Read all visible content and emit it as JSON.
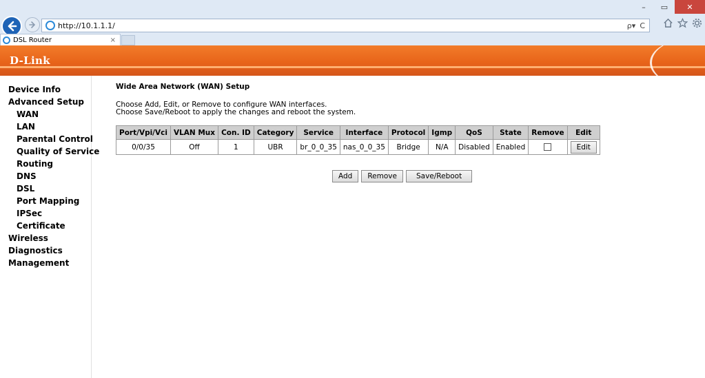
{
  "browser": {
    "url": "http://10.1.1.1/",
    "tab_title": "DSL Router",
    "tab_close": "×",
    "address_tools": [
      "ρ▾",
      "C"
    ],
    "window_controls": [
      "–",
      "▭",
      "✕"
    ],
    "right_icons": [
      "home-icon",
      "star-icon",
      "gear-icon"
    ]
  },
  "brand": {
    "logo": "D-Link",
    "accent": "#e8641a"
  },
  "sidebar": {
    "items": [
      {
        "label": "Device Info",
        "level": 1
      },
      {
        "label": "Advanced Setup",
        "level": 1
      },
      {
        "label": "WAN",
        "level": 2
      },
      {
        "label": "LAN",
        "level": 2
      },
      {
        "label": "Parental Control",
        "level": 2
      },
      {
        "label": "Quality of Service",
        "level": 2
      },
      {
        "label": "Routing",
        "level": 2
      },
      {
        "label": "DNS",
        "level": 2
      },
      {
        "label": "DSL",
        "level": 2
      },
      {
        "label": "Port Mapping",
        "level": 2
      },
      {
        "label": "IPSec",
        "level": 2
      },
      {
        "label": "Certificate",
        "level": 2
      },
      {
        "label": "Wireless",
        "level": 1
      },
      {
        "label": "Diagnostics",
        "level": 1
      },
      {
        "label": "Management",
        "level": 1
      }
    ]
  },
  "main": {
    "title": "Wide Area Network (WAN) Setup",
    "desc1": "Choose Add, Edit, or Remove to configure WAN interfaces.",
    "desc2": "Choose Save/Reboot to apply the changes and reboot the system.",
    "table": {
      "headers": [
        "Port/Vpi/Vci",
        "VLAN Mux",
        "Con. ID",
        "Category",
        "Service",
        "Interface",
        "Protocol",
        "Igmp",
        "QoS",
        "State",
        "Remove",
        "Edit"
      ],
      "rows": [
        [
          "0/0/35",
          "Off",
          "1",
          "UBR",
          "br_0_0_35",
          "nas_0_0_35",
          "Bridge",
          "N/A",
          "Disabled",
          "Enabled",
          "",
          "Edit"
        ]
      ]
    },
    "buttons": {
      "add": "Add",
      "remove": "Remove",
      "save_reboot": "Save/Reboot"
    }
  }
}
